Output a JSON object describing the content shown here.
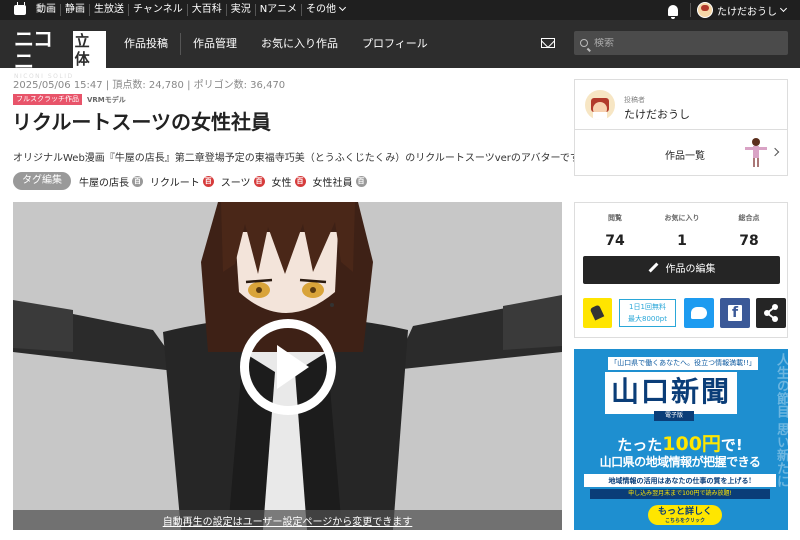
{
  "topbar": {
    "nav": [
      "動画",
      "静画",
      "生放送",
      "チャンネル",
      "大百科",
      "実況",
      "Nアニメ",
      "その他"
    ],
    "username": "たけだおうし"
  },
  "header": {
    "logo_text": "ニコニ",
    "logo_box": "立体",
    "logo_sub": "NICONI SOLID",
    "nav": [
      "作品投稿",
      "作品管理",
      "お気に入り作品",
      "プロフィール"
    ],
    "search_placeholder": "検索"
  },
  "work": {
    "meta": "2025/05/06 15:47 | 頂点数: 24,780 | ポリゴン数: 36,470",
    "badge_full": "フルスクラッチ作品",
    "badge_vrm": "VRMモデル",
    "title": "リクルートスーツの女性社員",
    "description": "オリジナルWeb漫画『牛屋の店長』第二章登場予定の東福寺巧美（とうふくじたくみ）のリクルートスーツverのアバターです。",
    "tag_edit_label": "タグ編集",
    "tags": [
      {
        "label": "牛屋の店長",
        "icon": "百",
        "color": "#999999"
      },
      {
        "label": "リクルート",
        "icon": "百",
        "color": "#d63b3b"
      },
      {
        "label": "スーツ",
        "icon": "百",
        "color": "#d63b3b"
      },
      {
        "label": "女性",
        "icon": "百",
        "color": "#d63b3b"
      },
      {
        "label": "女性社員",
        "icon": "百",
        "color": "#999999"
      }
    ],
    "autoplay_notice": "自動再生の設定はユーザー設定ページから変更できます"
  },
  "author": {
    "label": "投稿者",
    "name": "たけだおうし",
    "works_list": "作品一覧"
  },
  "stats": {
    "views_label": "閲覧",
    "views": "74",
    "favorites_label": "お気に入り",
    "favorites": "1",
    "total_label": "総合点",
    "total": "78",
    "edit_label": "作品の編集",
    "ad_line1": "1日1回無料",
    "ad_line2": "最大8000pt"
  },
  "ad": {
    "sub": "「山口県で働くあなたへ。役立つ情報満載!!」",
    "logo": "山口新聞",
    "edition": "電子版",
    "price_pre": "たった",
    "price_hl": "100円",
    "price_post": "で!",
    "head": "山口県の地域情報が把握できる",
    "strip": "地域情報の活用はあなたの仕事の質を上げる!",
    "note": "申し込み翌月末まで100円で読み放題!",
    "cta": "もっと詳しく",
    "cta_small": "こちらをクリック",
    "vertical": "人生の節目 思い新たに"
  },
  "colors": {
    "topbar": "#1f1f1f",
    "header": "#2d2d2d",
    "accent_red": "#d63b3b",
    "twitter": "#1d9bf0",
    "facebook": "#3b5998",
    "ad_blue": "#1e8fd0"
  }
}
